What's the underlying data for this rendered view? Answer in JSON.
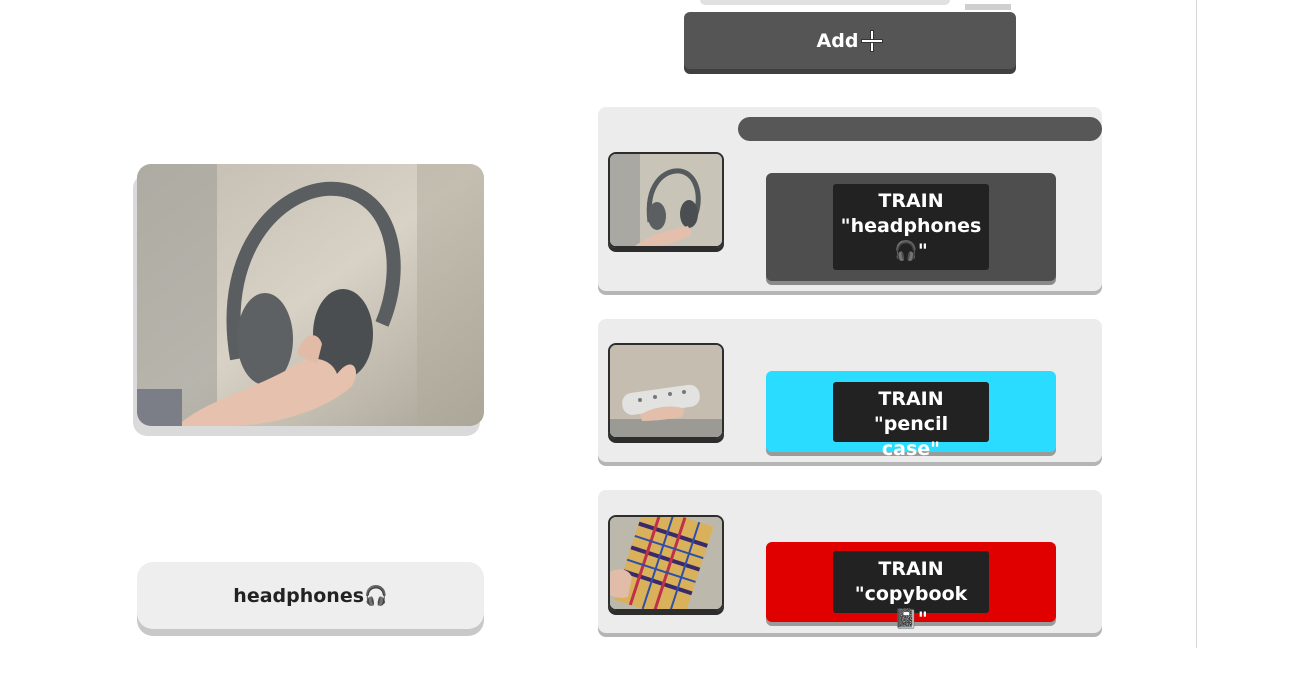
{
  "add_button": {
    "label": "Add",
    "icon": "plus-icon"
  },
  "prediction": {
    "label": "headphones🎧"
  },
  "classes": [
    {
      "train_label": "TRAIN\n\"headphones\n🎧\"",
      "color": "#4e4e4e",
      "thumb_icon": "headphones"
    },
    {
      "train_label": "TRAIN \"pencil\ncase\"",
      "color": "#2adcff",
      "thumb_icon": "pencil-case"
    },
    {
      "train_label": "TRAIN\n\"copybook📓\"",
      "color": "#e00000",
      "thumb_icon": "copybook"
    }
  ]
}
